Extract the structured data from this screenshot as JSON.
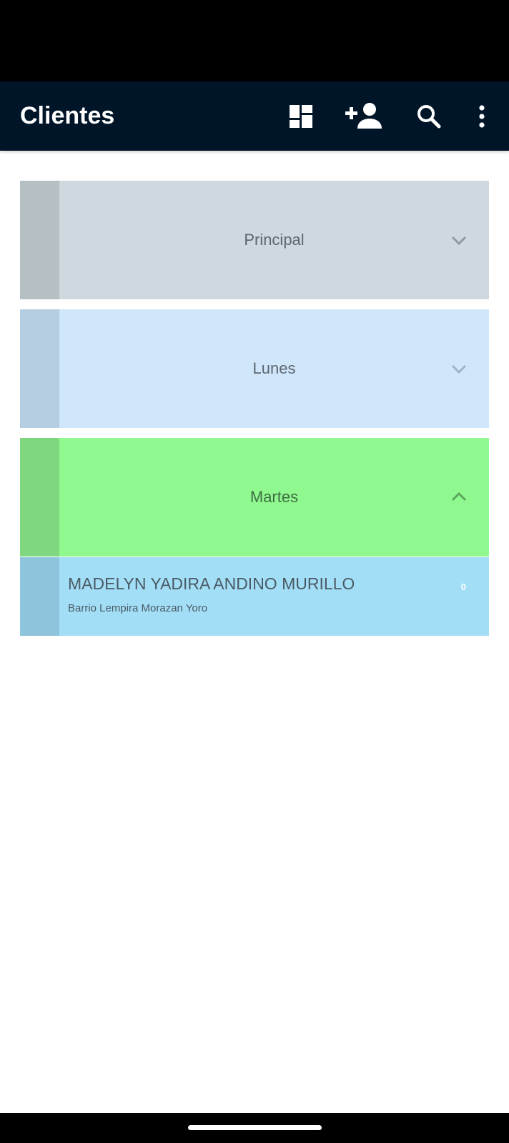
{
  "header": {
    "title": "Clientes",
    "icons": [
      "dashboard-icon",
      "add-person-icon",
      "search-icon",
      "more-vert-icon"
    ]
  },
  "groups": [
    {
      "label": "Principal",
      "expanded": false,
      "stripe_color": "#b6bfc4",
      "bg_color": "#cfd8de",
      "text_color": "#5b6670"
    },
    {
      "label": "Lunes",
      "expanded": false,
      "stripe_color": "#b5cde0",
      "bg_color": "#d0e6fa",
      "text_color": "#5b6670"
    },
    {
      "label": "Martes",
      "expanded": true,
      "stripe_color": "#7fd880",
      "bg_color": "#8ff98f",
      "text_color": "#3f6e43"
    }
  ],
  "clients": [
    {
      "name": "MADELYN YADIRA ANDINO MURILLO",
      "address": "Barrio Lempira Morazan Yoro",
      "count": "0",
      "bg_color": "#a3def7"
    }
  ]
}
